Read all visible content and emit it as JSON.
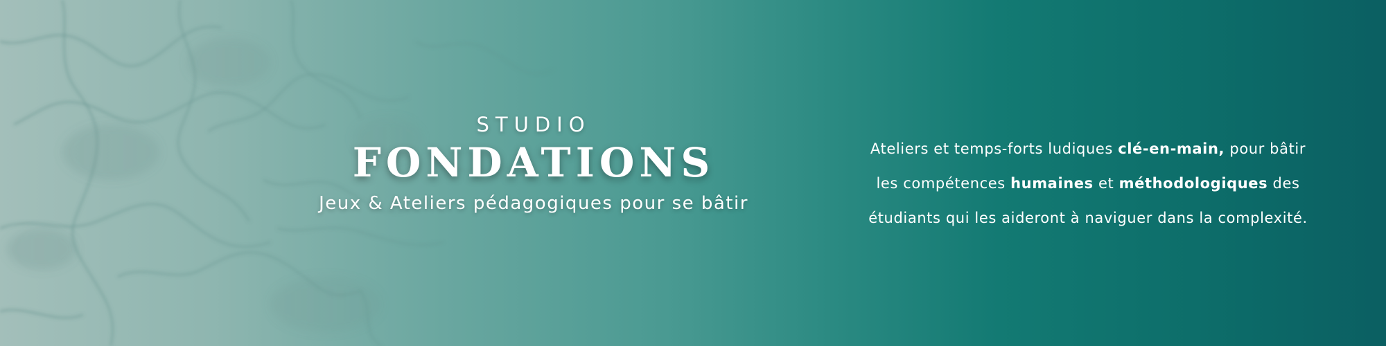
{
  "banner": {
    "studio_label": "STUDIO",
    "title": "FONDATIONS",
    "tagline": "Jeux & Ateliers pédagogiques pour se bâtir",
    "description": {
      "line1_before": "Ateliers et temps-forts ludiques ",
      "line1_bold": "clé-en-main,",
      "line1_after": " pour bâtir",
      "line2_before": "les compétences ",
      "line2_bold1": "humaines",
      "line2_middle": " et ",
      "line2_bold2": "méthodologiques",
      "line2_after": " des",
      "line3": "étudiants qui les aideront à naviguer dans la complexité."
    },
    "colors": {
      "gradient_start": "#a3bfba",
      "gradient_end": "#0b5f62",
      "text": "#ffffff"
    }
  }
}
